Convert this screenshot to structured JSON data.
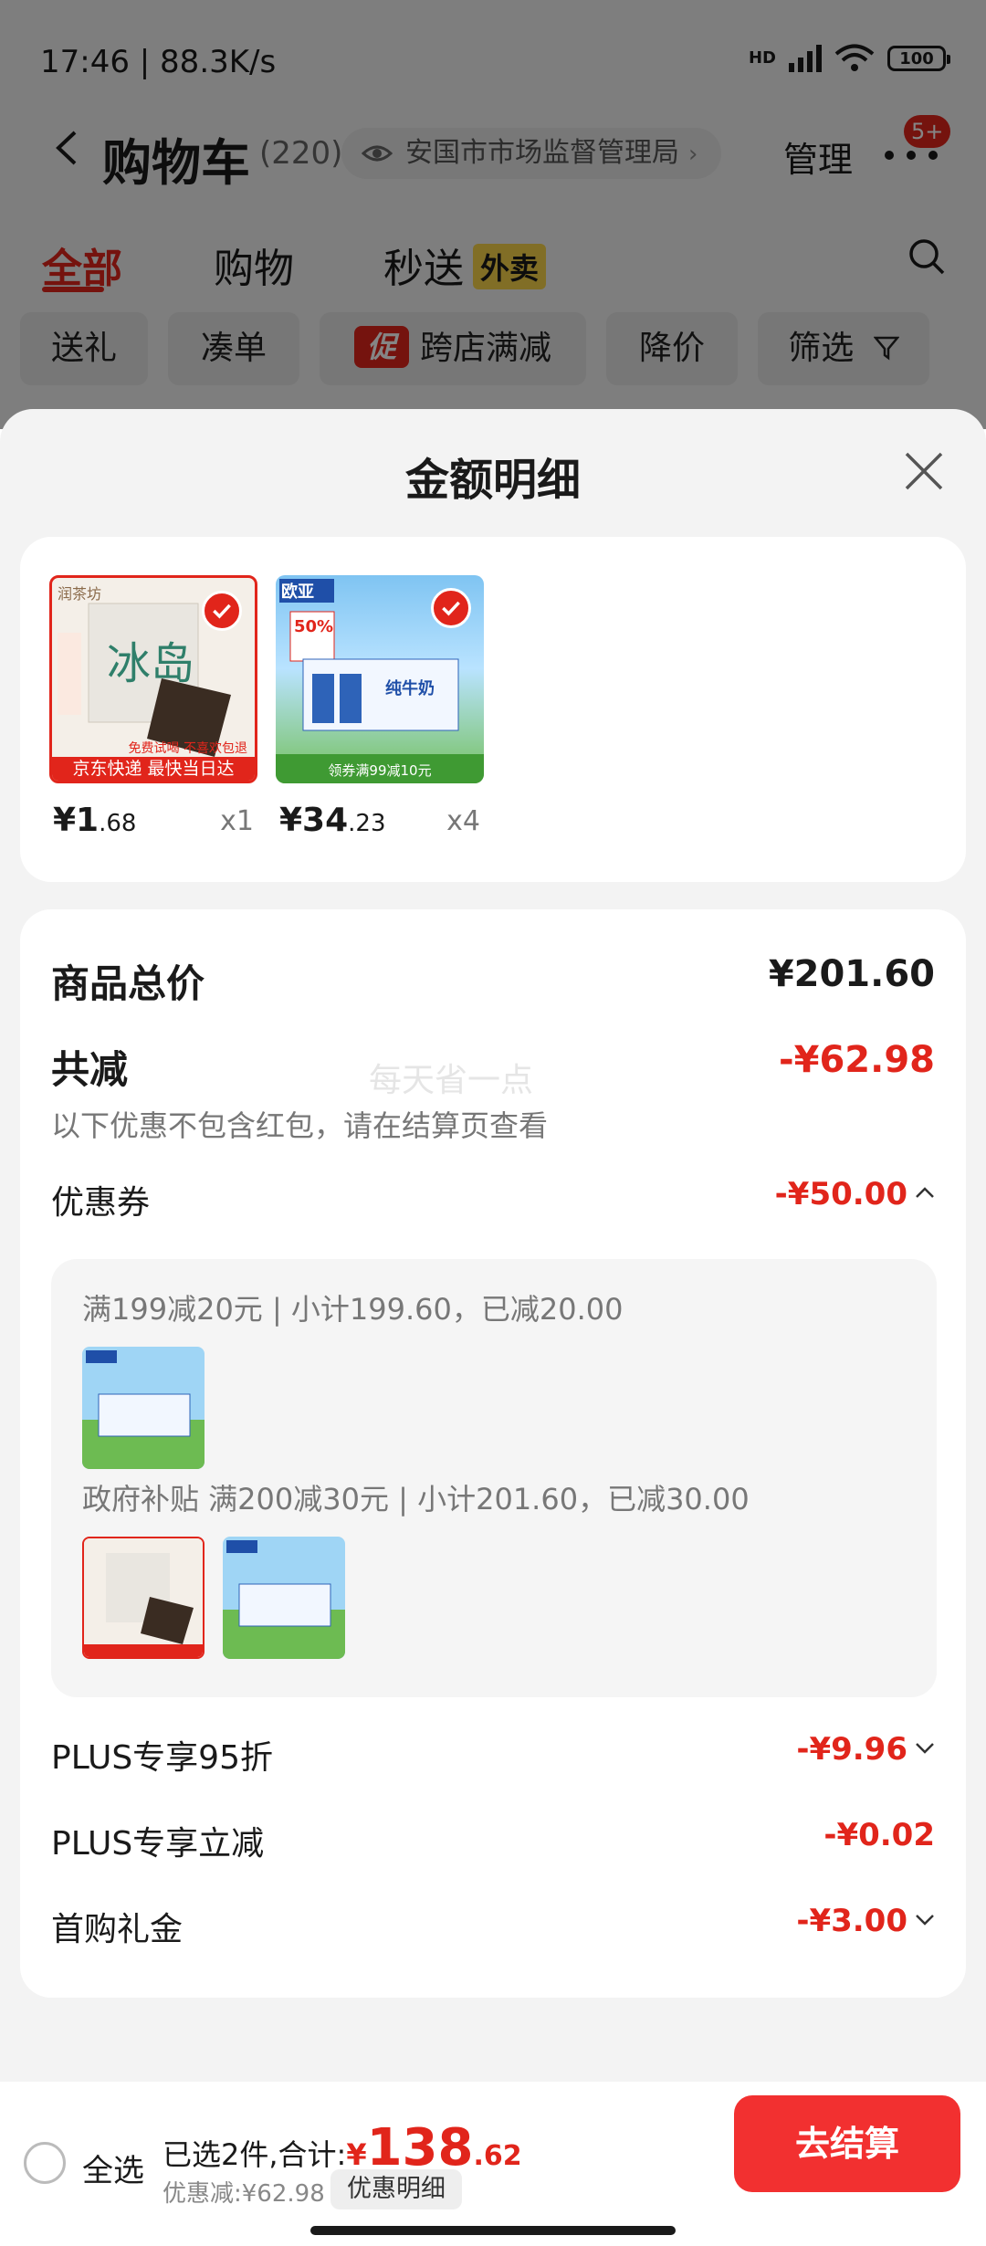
{
  "status_bar": {
    "time_speed": "17:46 | 88.3K/s",
    "network": "HD",
    "battery": "100"
  },
  "navbar": {
    "title": "购物车",
    "count": "(220)",
    "location": "安国市市场监督管理局",
    "manage": "管理",
    "badge": "5+"
  },
  "tabs": [
    {
      "label": "全部"
    },
    {
      "label": "购物"
    },
    {
      "label": "秒送",
      "tag": "外卖"
    }
  ],
  "chips": [
    "送礼",
    "凑单",
    "跨店满减",
    "降价",
    "筛选"
  ],
  "chip_promo_tag": "促",
  "sheet": {
    "title": "金额明细",
    "products": [
      {
        "price_int": "¥1",
        "price_dec": ".68",
        "qty": "x1",
        "banner": "京东快递  最快当日达",
        "badge": "免费试喝 不喜欢包退",
        "brand": "润茶坊"
      },
      {
        "price_int": "¥34",
        "price_dec": ".23",
        "qty": "x4",
        "brand": "欧亚",
        "badge": "50%",
        "product_name": "纯牛奶",
        "promo_text": "领券满99减10元"
      }
    ],
    "summary": {
      "total_label": "商品总价",
      "total_value": "¥201.60",
      "reduce_label": "共减",
      "reduce_value": "-¥62.98",
      "note": "以下优惠不包含红包，请在结算页查看",
      "watermark": "每天省一点",
      "coupon_label": "优惠券",
      "coupon_value": "-¥50.00"
    },
    "coupons": [
      {
        "text": "满199减20元 | 小计199.60，已减20.00"
      },
      {
        "text": "政府补贴 满200减30元 | 小计201.60，已减30.00"
      }
    ],
    "other_discounts": [
      {
        "label": "PLUS专享95折",
        "value": "-¥9.96"
      },
      {
        "label": "PLUS专享立减",
        "value": "-¥0.02"
      },
      {
        "label": "首购礼金",
        "value": "-¥3.00"
      }
    ]
  },
  "bottom_bar": {
    "select_all": "全选",
    "selected_prefix": "已选2件,合计:",
    "currency": "¥",
    "total_int": "138",
    "total_dec": ".62",
    "discount": "优惠减:¥62.98",
    "detail_button": "优惠明细",
    "checkout": "去结算"
  },
  "colors": {
    "accent_red": "#e1251b",
    "checkout_red": "#f23030",
    "promo_yellow": "#f7d44a"
  }
}
